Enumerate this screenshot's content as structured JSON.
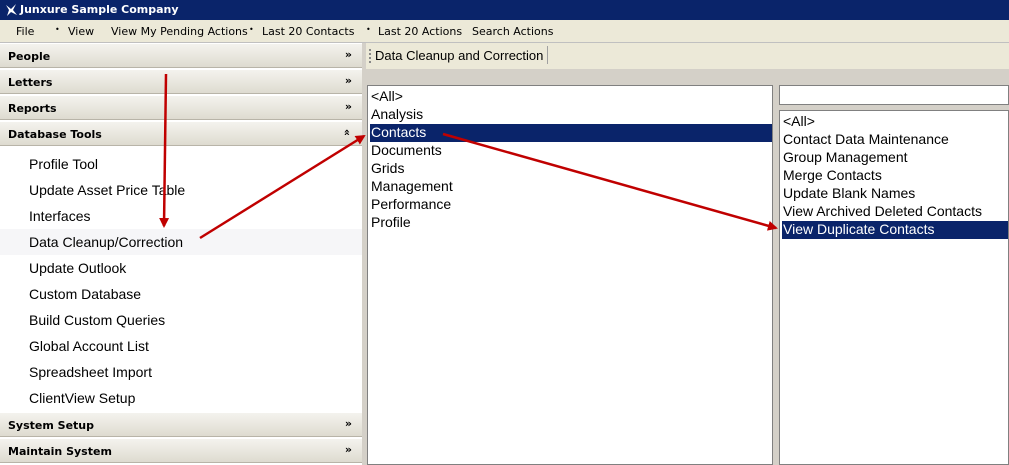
{
  "window": {
    "title": "Junxure Sample Company"
  },
  "menubar": {
    "items": [
      {
        "label": "File"
      },
      {
        "label": "View"
      },
      {
        "label": "View My Pending Actions"
      },
      {
        "label": "Last 20 Contacts"
      },
      {
        "label": "Last 20 Actions"
      },
      {
        "label": "Search Actions"
      }
    ]
  },
  "sidebar": {
    "sections": [
      {
        "label": "People",
        "state": "collapsed"
      },
      {
        "label": "Letters",
        "state": "collapsed"
      },
      {
        "label": "Reports",
        "state": "collapsed"
      },
      {
        "label": "Database Tools",
        "state": "expanded"
      },
      {
        "label": "System Setup",
        "state": "collapsed"
      },
      {
        "label": "Maintain System",
        "state": "collapsed"
      }
    ],
    "tools": [
      {
        "label": "Profile Tool"
      },
      {
        "label": "Update Asset Price Table"
      },
      {
        "label": "Interfaces"
      },
      {
        "label": "Data Cleanup/Correction",
        "selected": true
      },
      {
        "label": "Update Outlook"
      },
      {
        "label": "Custom Database"
      },
      {
        "label": "Build Custom Queries"
      },
      {
        "label": "Global Account List"
      },
      {
        "label": "Spreadsheet Import"
      },
      {
        "label": "ClientView Setup"
      }
    ]
  },
  "content": {
    "title": "Data Cleanup and Correction",
    "search": {
      "value": ""
    },
    "categories": [
      {
        "label": "<All>"
      },
      {
        "label": "Analysis"
      },
      {
        "label": "Contacts",
        "selected": true
      },
      {
        "label": "Documents"
      },
      {
        "label": "Grids"
      },
      {
        "label": "Management"
      },
      {
        "label": "Performance"
      },
      {
        "label": "Profile"
      }
    ],
    "tasks": [
      {
        "label": "<All>"
      },
      {
        "label": "Contact Data Maintenance"
      },
      {
        "label": "Group Management"
      },
      {
        "label": "Merge Contacts"
      },
      {
        "label": "Update Blank Names"
      },
      {
        "label": "View Archived Deleted Contacts"
      },
      {
        "label": "View Duplicate Contacts",
        "selected": true
      }
    ]
  },
  "colors": {
    "titlebar": "#0a246a",
    "selection": "#0a246a",
    "annotation_arrow": "#c00000"
  }
}
